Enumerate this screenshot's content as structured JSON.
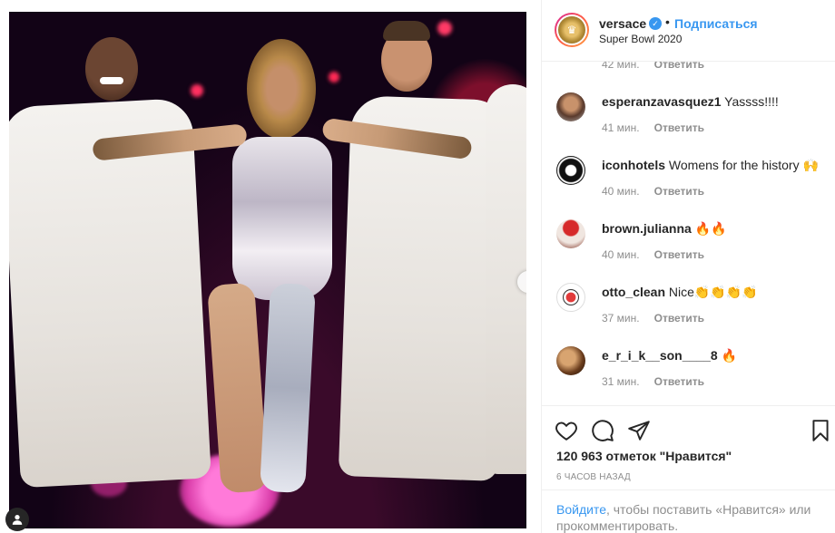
{
  "header": {
    "username": "versace",
    "dot": "•",
    "follow_label": "Подписаться",
    "location": "Super Bowl 2020"
  },
  "comments": [
    {
      "username": "",
      "text": "",
      "time": "42 мин.",
      "reply": "Ответить"
    },
    {
      "username": "esperanzavasquez1",
      "text": "Yassss!!!!",
      "time": "41 мин.",
      "reply": "Ответить"
    },
    {
      "username": "iconhotels",
      "text": "Womens for the history 🙌",
      "time": "40 мин.",
      "reply": "Ответить"
    },
    {
      "username": "brown.julianna",
      "text": "🔥🔥",
      "time": "40 мин.",
      "reply": "Ответить"
    },
    {
      "username": "otto_clean",
      "text": "Nice👏👏👏👏",
      "time": "37 мин.",
      "reply": "Ответить"
    },
    {
      "username": "e_r_i_k__son____8",
      "text": "🔥",
      "time": "31 мин.",
      "reply": "Ответить"
    }
  ],
  "icons": [
    "heart-icon",
    "comment-icon",
    "share-icon",
    "bookmark-icon",
    "chevron-right-icon",
    "verified-icon",
    "user-icon"
  ],
  "likes": "120 963 отметок \"Нравится\"",
  "time_ago": "6 ЧАСОВ НАЗАД",
  "login": {
    "link": "Войдите",
    "text": ", чтобы поставить «Нравится» или прокомментировать."
  },
  "carousel": {
    "slides": 3,
    "active": 1
  },
  "colors": {
    "accent": "#3897f0",
    "text": "#262626",
    "muted": "#8e8e8e",
    "border": "#efefef"
  }
}
